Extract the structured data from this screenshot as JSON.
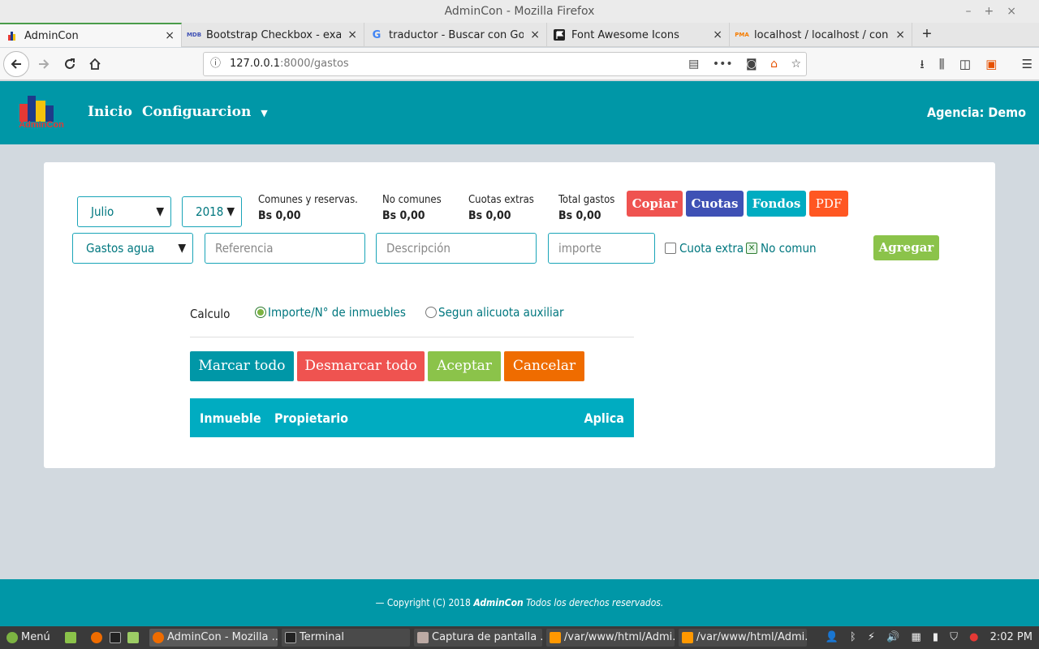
{
  "window": {
    "title": "AdminCon - Mozilla Firefox",
    "controls": [
      "–",
      "+",
      "×"
    ]
  },
  "tabs": [
    {
      "label": "AdminCon",
      "icon": "admincon-favicon"
    },
    {
      "label": "Bootstrap Checkbox - exampl",
      "icon": "mdb-favicon"
    },
    {
      "label": "traductor - Buscar con Google",
      "icon": "google-favicon"
    },
    {
      "label": "Font Awesome Icons",
      "icon": "flag-favicon"
    },
    {
      "label": "localhost / localhost / condom",
      "icon": "pma-favicon"
    }
  ],
  "tab_close": "×",
  "new_tab": "+",
  "url": {
    "host": "127.0.0.1",
    "path": ":8000/gastos"
  },
  "app": {
    "logo_text": "AdminCon",
    "nav": [
      "Inicio",
      "Configuarcion"
    ],
    "agency": "Agencia: Demo"
  },
  "filters": {
    "month": "Julio",
    "year": "2018"
  },
  "stats": [
    {
      "label": "Comunes y reservas.",
      "value": "Bs 0,00"
    },
    {
      "label": "No comunes",
      "value": "Bs 0,00"
    },
    {
      "label": "Cuotas extras",
      "value": "Bs 0,00"
    },
    {
      "label": "Total gastos",
      "value": "Bs 0,00"
    }
  ],
  "actions": [
    {
      "label": "Copiar",
      "color": "#ef5350"
    },
    {
      "label": "Cuotas",
      "color": "#3f51b5"
    },
    {
      "label": "Fondos",
      "color": "#00acc1"
    },
    {
      "label": "PDF",
      "color": "#ff5722"
    }
  ],
  "form": {
    "expense_type": "Gastos agua",
    "reference_placeholder": "Referencia",
    "description_placeholder": "Descripción",
    "amount_placeholder": "importe",
    "cuota_extra": "Cuota extra",
    "no_comun": "No comun",
    "add_button": "Agregar"
  },
  "calc": {
    "label": "Calculo",
    "option1": "Importe/N° de inmuebles",
    "option2": "Segun alicuota auxiliar"
  },
  "buttons": {
    "mark_all": "Marcar todo",
    "unmark_all": "Desmarcar todo",
    "accept": "Aceptar",
    "cancel": "Cancelar"
  },
  "table": {
    "headers": [
      "Inmueble",
      "Propietario",
      "Aplica"
    ]
  },
  "footer": {
    "prefix": "— Copyright (C) 2018 ",
    "brand": "AdminCon",
    "suffix": " Todos los derechos reservados."
  },
  "taskbar": {
    "menu": "Menú",
    "windows": [
      "AdminCon - Mozilla ...",
      "Terminal",
      "Captura de pantalla ...",
      "/var/www/html/Admi...",
      "/var/www/html/Admi..."
    ],
    "clock": "2:02 PM"
  }
}
